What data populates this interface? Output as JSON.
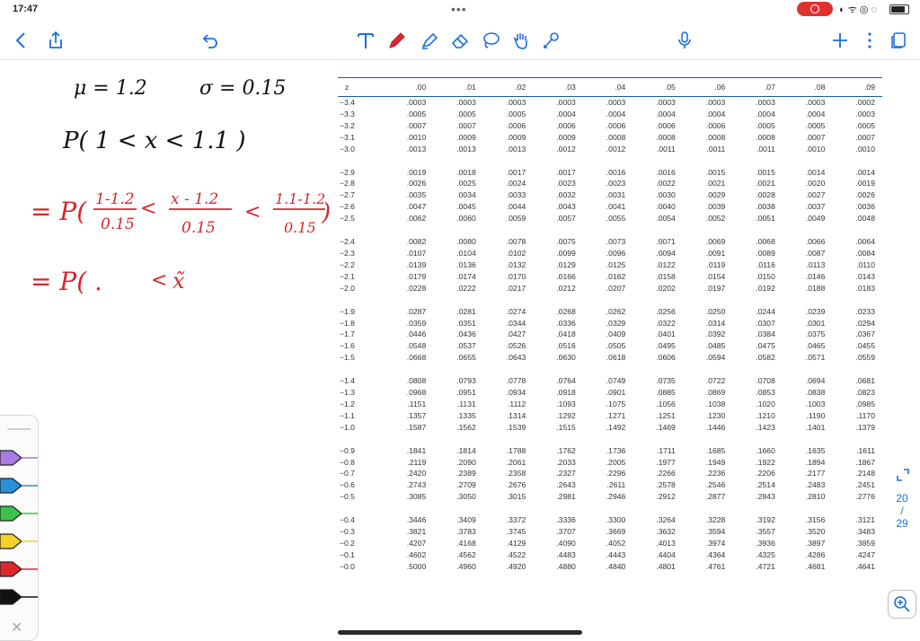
{
  "status": {
    "time": "17:47",
    "battery_level": 0.85
  },
  "toolbar": {
    "items": [
      "back-icon",
      "share-icon",
      "undo-icon",
      "text-tool-icon",
      "pen-tool-icon",
      "highlighter-icon",
      "eraser-icon",
      "lasso-icon",
      "hand-icon",
      "laser-icon",
      "microphone-icon",
      "add-icon",
      "more-icon",
      "pages-icon"
    ]
  },
  "handwriting": {
    "line1_mu": "μ = 1.2",
    "line1_sigma": "σ = 0.15",
    "line2": "P( 1 < x < 1.1 )",
    "line3_prefix": "= P(",
    "frac1_num": "1-1.2",
    "frac1_den": "0.15",
    "lt": "<",
    "frac2_num": "x - 1.2",
    "frac2_den": "0.15",
    "frac3_num": "1.1-1.2",
    "frac3_den": "0.15",
    "line3_suffix": ")",
    "line4_prefix": "= P( .",
    "line4_lt": "<",
    "line4_var": "x̃"
  },
  "colors": {
    "red_ink": "#d8262d",
    "black_ink": "#111111",
    "accent": "#1f6fe0",
    "table_rule": "#1f5aa8"
  },
  "ztable": {
    "headers": [
      "z",
      ".00",
      ".01",
      ".02",
      ".03",
      ".04",
      ".05",
      ".06",
      ".07",
      ".08",
      ".09"
    ],
    "blocks": [
      [
        [
          "−3.4",
          ".0003",
          ".0003",
          ".0003",
          ".0003",
          ".0003",
          ".0003",
          ".0003",
          ".0003",
          ".0003",
          ".0002"
        ],
        [
          "−3.3",
          ".0005",
          ".0005",
          ".0005",
          ".0004",
          ".0004",
          ".0004",
          ".0004",
          ".0004",
          ".0004",
          ".0003"
        ],
        [
          "−3.2",
          ".0007",
          ".0007",
          ".0006",
          ".0006",
          ".0006",
          ".0006",
          ".0006",
          ".0005",
          ".0005",
          ".0005"
        ],
        [
          "−3.1",
          ".0010",
          ".0009",
          ".0009",
          ".0009",
          ".0008",
          ".0008",
          ".0008",
          ".0008",
          ".0007",
          ".0007"
        ],
        [
          "−3.0",
          ".0013",
          ".0013",
          ".0013",
          ".0012",
          ".0012",
          ".0011",
          ".0011",
          ".0011",
          ".0010",
          ".0010"
        ]
      ],
      [
        [
          "−2.9",
          ".0019",
          ".0018",
          ".0017",
          ".0017",
          ".0016",
          ".0016",
          ".0015",
          ".0015",
          ".0014",
          ".0014"
        ],
        [
          "−2.8",
          ".0026",
          ".0025",
          ".0024",
          ".0023",
          ".0023",
          ".0022",
          ".0021",
          ".0021",
          ".0020",
          ".0019"
        ],
        [
          "−2.7",
          ".0035",
          ".0034",
          ".0033",
          ".0032",
          ".0031",
          ".0030",
          ".0029",
          ".0028",
          ".0027",
          ".0026"
        ],
        [
          "−2.6",
          ".0047",
          ".0045",
          ".0044",
          ".0043",
          ".0041",
          ".0040",
          ".0039",
          ".0038",
          ".0037",
          ".0036"
        ],
        [
          "−2.5",
          ".0062",
          ".0060",
          ".0059",
          ".0057",
          ".0055",
          ".0054",
          ".0052",
          ".0051",
          ".0049",
          ".0048"
        ]
      ],
      [
        [
          "−2.4",
          ".0082",
          ".0080",
          ".0078",
          ".0075",
          ".0073",
          ".0071",
          ".0069",
          ".0068",
          ".0066",
          ".0064"
        ],
        [
          "−2.3",
          ".0107",
          ".0104",
          ".0102",
          ".0099",
          ".0096",
          ".0094",
          ".0091",
          ".0089",
          ".0087",
          ".0084"
        ],
        [
          "−2.2",
          ".0139",
          ".0136",
          ".0132",
          ".0129",
          ".0125",
          ".0122",
          ".0119",
          ".0116",
          ".0113",
          ".0110"
        ],
        [
          "−2.1",
          ".0179",
          ".0174",
          ".0170",
          ".0166",
          ".0162",
          ".0158",
          ".0154",
          ".0150",
          ".0146",
          ".0143"
        ],
        [
          "−2.0",
          ".0228",
          ".0222",
          ".0217",
          ".0212",
          ".0207",
          ".0202",
          ".0197",
          ".0192",
          ".0188",
          ".0183"
        ]
      ],
      [
        [
          "−1.9",
          ".0287",
          ".0281",
          ".0274",
          ".0268",
          ".0262",
          ".0256",
          ".0250",
          ".0244",
          ".0239",
          ".0233"
        ],
        [
          "−1.8",
          ".0359",
          ".0351",
          ".0344",
          ".0336",
          ".0329",
          ".0322",
          ".0314",
          ".0307",
          ".0301",
          ".0294"
        ],
        [
          "−1.7",
          ".0446",
          ".0436",
          ".0427",
          ".0418",
          ".0409",
          ".0401",
          ".0392",
          ".0384",
          ".0375",
          ".0367"
        ],
        [
          "−1.6",
          ".0548",
          ".0537",
          ".0526",
          ".0516",
          ".0505",
          ".0495",
          ".0485",
          ".0475",
          ".0465",
          ".0455"
        ],
        [
          "−1.5",
          ".0668",
          ".0655",
          ".0643",
          ".0630",
          ".0618",
          ".0606",
          ".0594",
          ".0582",
          ".0571",
          ".0559"
        ]
      ],
      [
        [
          "−1.4",
          ".0808",
          ".0793",
          ".0778",
          ".0764",
          ".0749",
          ".0735",
          ".0722",
          ".0708",
          ".0694",
          ".0681"
        ],
        [
          "−1.3",
          ".0968",
          ".0951",
          ".0934",
          ".0918",
          ".0901",
          ".0885",
          ".0869",
          ".0853",
          ".0838",
          ".0823"
        ],
        [
          "−1.2",
          ".1151",
          ".1131",
          ".1112",
          ".1093",
          ".1075",
          ".1056",
          ".1038",
          ".1020",
          ".1003",
          ".0985"
        ],
        [
          "−1.1",
          ".1357",
          ".1335",
          ".1314",
          ".1292",
          ".1271",
          ".1251",
          ".1230",
          ".1210",
          ".1190",
          ".1170"
        ],
        [
          "−1.0",
          ".1587",
          ".1562",
          ".1539",
          ".1515",
          ".1492",
          ".1469",
          ".1446",
          ".1423",
          ".1401",
          ".1379"
        ]
      ],
      [
        [
          "−0.9",
          ".1841",
          ".1814",
          ".1788",
          ".1762",
          ".1736",
          ".1711",
          ".1685",
          ".1660",
          ".1635",
          ".1611"
        ],
        [
          "−0.8",
          ".2119",
          ".2090",
          ".2061",
          ".2033",
          ".2005",
          ".1977",
          ".1949",
          ".1922",
          ".1894",
          ".1867"
        ],
        [
          "−0.7",
          ".2420",
          ".2389",
          ".2358",
          ".2327",
          ".2296",
          ".2266",
          ".2236",
          ".2206",
          ".2177",
          ".2148"
        ],
        [
          "−0.6",
          ".2743",
          ".2709",
          ".2676",
          ".2643",
          ".2611",
          ".2578",
          ".2546",
          ".2514",
          ".2483",
          ".2451"
        ],
        [
          "−0.5",
          ".3085",
          ".3050",
          ".3015",
          ".2981",
          ".2946",
          ".2912",
          ".2877",
          ".2843",
          ".2810",
          ".2776"
        ]
      ],
      [
        [
          "−0.4",
          ".3446",
          ".3409",
          ".3372",
          ".3336",
          ".3300",
          ".3264",
          ".3228",
          ".3192",
          ".3156",
          ".3121"
        ],
        [
          "−0.3",
          ".3821",
          ".3783",
          ".3745",
          ".3707",
          ".3669",
          ".3632",
          ".3594",
          ".3557",
          ".3520",
          ".3483"
        ],
        [
          "−0.2",
          ".4207",
          ".4168",
          ".4129",
          ".4090",
          ".4052",
          ".4013",
          ".3974",
          ".3936",
          ".3897",
          ".3859"
        ],
        [
          "−0.1",
          ".4602",
          ".4562",
          ".4522",
          ".4483",
          ".4443",
          ".4404",
          ".4364",
          ".4325",
          ".4286",
          ".4247"
        ],
        [
          "−0.0",
          ".5000",
          ".4960",
          ".4920",
          ".4880",
          ".4840",
          ".4801",
          ".4761",
          ".4721",
          ".4681",
          ".4641"
        ]
      ]
    ]
  },
  "pens": [
    {
      "name": "purple-pen-icon",
      "color": "#a77be0"
    },
    {
      "name": "blue-pen-icon",
      "color": "#2a8fd6"
    },
    {
      "name": "green-pen-icon",
      "color": "#3cc24a"
    },
    {
      "name": "yellow-pen-icon",
      "color": "#f3d12b"
    },
    {
      "name": "red-pen-icon",
      "color": "#e0262d"
    },
    {
      "name": "black-pen-icon",
      "color": "#111111"
    }
  ],
  "pages": {
    "current": "20",
    "sep": "/",
    "total": "29"
  }
}
